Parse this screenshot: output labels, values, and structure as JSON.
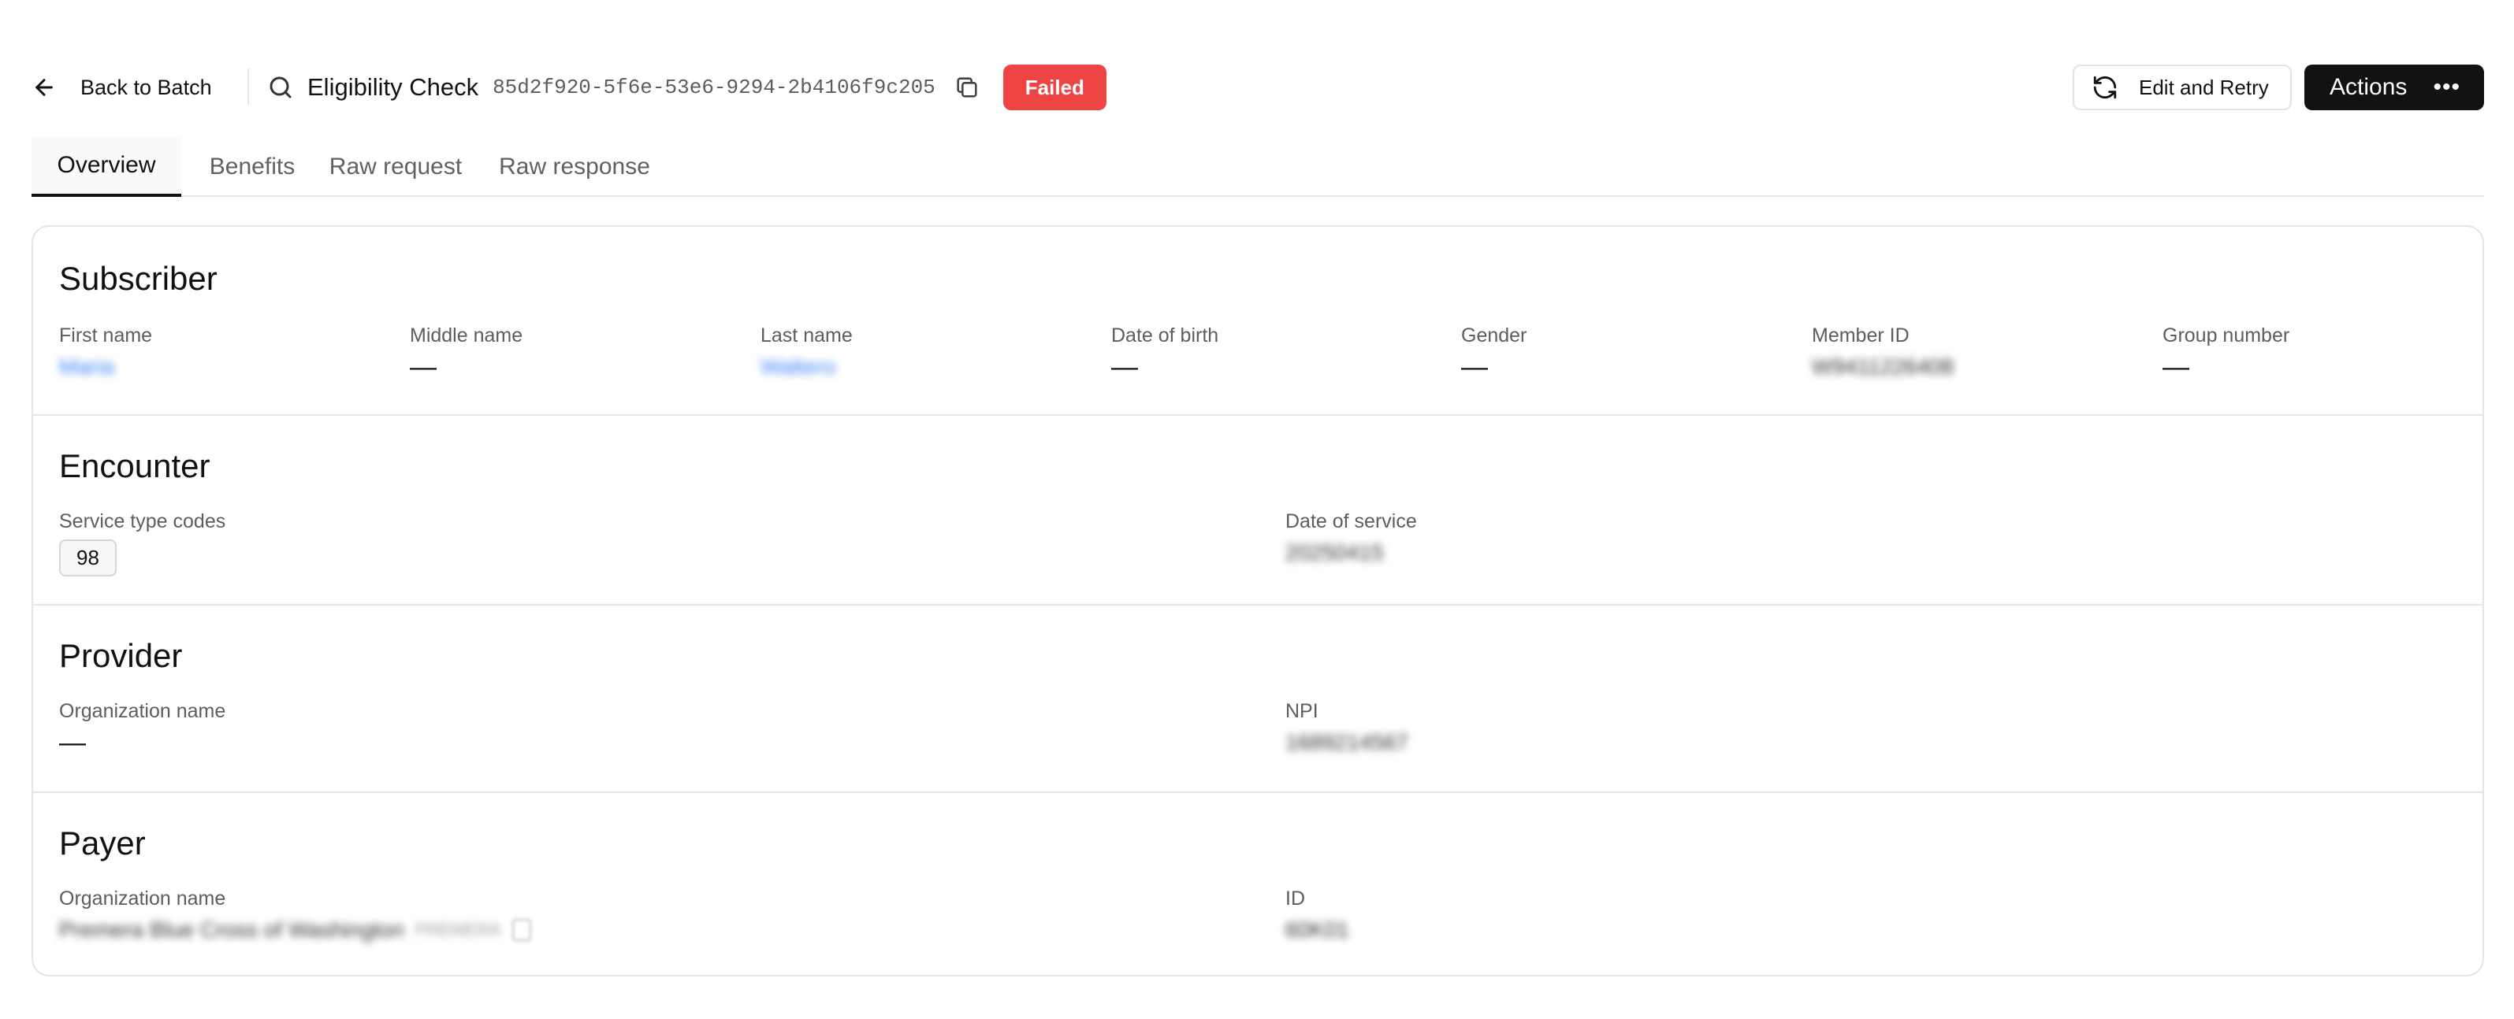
{
  "header": {
    "back_label": "Back to Batch",
    "title": "Eligibility Check",
    "uuid": "85d2f920-5f6e-53e6-9294-2b4106f9c205",
    "status": "Failed",
    "status_color": "#ef4444",
    "edit_retry_label": "Edit and Retry",
    "actions_label": "Actions",
    "icons": [
      "arrow-left-icon",
      "search-icon",
      "copy-icon",
      "refresh-icon",
      "more-horizontal-icon"
    ]
  },
  "tabs": [
    {
      "label": "Overview",
      "active": true
    },
    {
      "label": "Benefits",
      "active": false
    },
    {
      "label": "Raw request",
      "active": false
    },
    {
      "label": "Raw response",
      "active": false
    }
  ],
  "subscriber": {
    "title": "Subscriber",
    "fields": [
      {
        "label": "First name",
        "value": "Maria"
      },
      {
        "label": "Middle name",
        "value": "—"
      },
      {
        "label": "Last name",
        "value": "Waltero"
      },
      {
        "label": "Date of birth",
        "value": "—"
      },
      {
        "label": "Gender",
        "value": "—"
      },
      {
        "label": "Member ID",
        "value": "W9411226408"
      },
      {
        "label": "Group number",
        "value": "—"
      }
    ]
  },
  "encounter": {
    "title": "Encounter",
    "service_type_label": "Service type codes",
    "service_type_code": "98",
    "date_label": "Date of service",
    "date_value": "20250415"
  },
  "provider": {
    "title": "Provider",
    "org_label": "Organization name",
    "org_value": "—",
    "npi_label": "NPI",
    "npi_value": "1689214567"
  },
  "payer": {
    "title": "Payer",
    "org_label": "Organization name",
    "org_value": "Premera Blue Cross of Washington",
    "org_sub": "PREMERA",
    "id_label": "ID",
    "id_value": "60K01"
  }
}
